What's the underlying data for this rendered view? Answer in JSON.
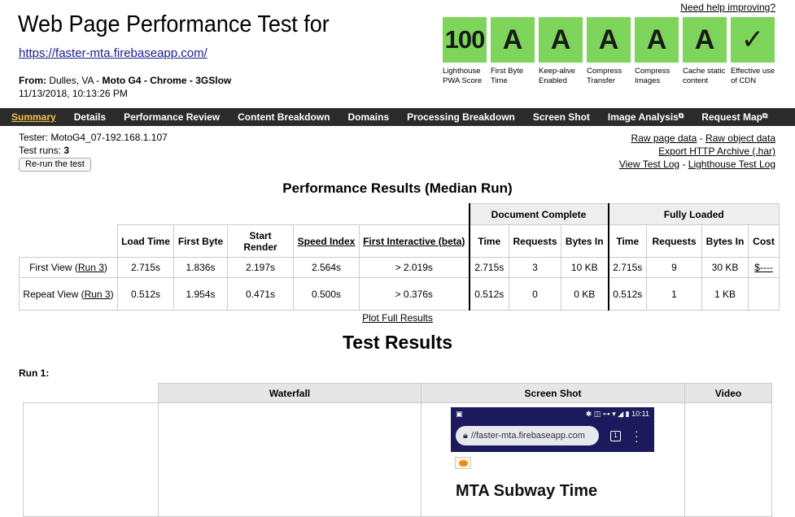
{
  "header": {
    "title": "Web Page Performance Test for",
    "url": "https://faster-mta.firebaseapp.com/",
    "from_label": "From:",
    "from_location": "Dulles, VA",
    "from_sep1": "-",
    "from_device": "Moto G4",
    "from_sep2": "-",
    "from_browser": "Chrome",
    "from_sep3": "-",
    "from_connection": "3GSlow",
    "date": "11/13/2018, 10:13:26 PM",
    "help_link": "Need help improving?"
  },
  "grades": [
    {
      "value": "100",
      "label": "Lighthouse PWA Score"
    },
    {
      "value": "A",
      "label": "First Byte Time"
    },
    {
      "value": "A",
      "label": "Keep-alive Enabled"
    },
    {
      "value": "A",
      "label": "Compress Transfer"
    },
    {
      "value": "A",
      "label": "Compress Images"
    },
    {
      "value": "A",
      "label": "Cache static content"
    },
    {
      "value": "✓",
      "label": "Effective use of CDN"
    }
  ],
  "grade_color": "#7ed55c",
  "nav": {
    "items": [
      "Summary",
      "Details",
      "Performance Review",
      "Content Breakdown",
      "Domains",
      "Processing Breakdown",
      "Screen Shot",
      "Image Analysis",
      "Request Map"
    ],
    "external_icon": "external-link-icon",
    "active_color": "#f2c14e"
  },
  "test_info": {
    "tester": "Tester: MotoG4_07-192.168.1.107",
    "runs_label": "Test runs:",
    "runs_value": "3",
    "rerun_button": "Re-run the test"
  },
  "links": {
    "raw_page": "Raw page data",
    "dash": "-",
    "raw_object": "Raw object data",
    "export_har": "Export HTTP Archive (.har)",
    "view_log": "View Test Log",
    "lighthouse_log": "Lighthouse Test Log"
  },
  "performance": {
    "title": "Performance Results (Median Run)",
    "group_doc": "Document Complete",
    "group_full": "Fully Loaded",
    "headers": [
      "Load Time",
      "First Byte",
      "Start Render",
      "Speed Index",
      "First Interactive (beta)"
    ],
    "doc_headers": [
      "Time",
      "Requests",
      "Bytes In"
    ],
    "full_headers": [
      "Time",
      "Requests",
      "Bytes In",
      "Cost"
    ],
    "rows": [
      {
        "label": "First View (",
        "run_link": "Run 3",
        "label_end": ")",
        "values": [
          "2.715s",
          "1.836s",
          "2.197s",
          "2.564s",
          "> 2.019s"
        ],
        "doc": [
          "2.715s",
          "3",
          "10 KB"
        ],
        "full": [
          "2.715s",
          "9",
          "30 KB",
          "$----"
        ]
      },
      {
        "label": "Repeat View (",
        "run_link": "Run 3",
        "label_end": ")",
        "values": [
          "0.512s",
          "1.954s",
          "0.471s",
          "0.500s",
          "> 0.376s"
        ],
        "doc": [
          "0.512s",
          "0",
          "0 KB"
        ],
        "full": [
          "0.512s",
          "1",
          "1 KB",
          ""
        ]
      }
    ],
    "plot_link": "Plot Full Results"
  },
  "results": {
    "title": "Test Results",
    "run_label": "Run 1:",
    "columns": [
      "Waterfall",
      "Screen Shot",
      "Video"
    ]
  },
  "screenshot": {
    "time": "10:11",
    "url_text": "//faster-mta.firebaseapp.com",
    "tabs_count": "1",
    "heading": "MTA Subway Time",
    "bar_color": "#1c1a5c"
  }
}
